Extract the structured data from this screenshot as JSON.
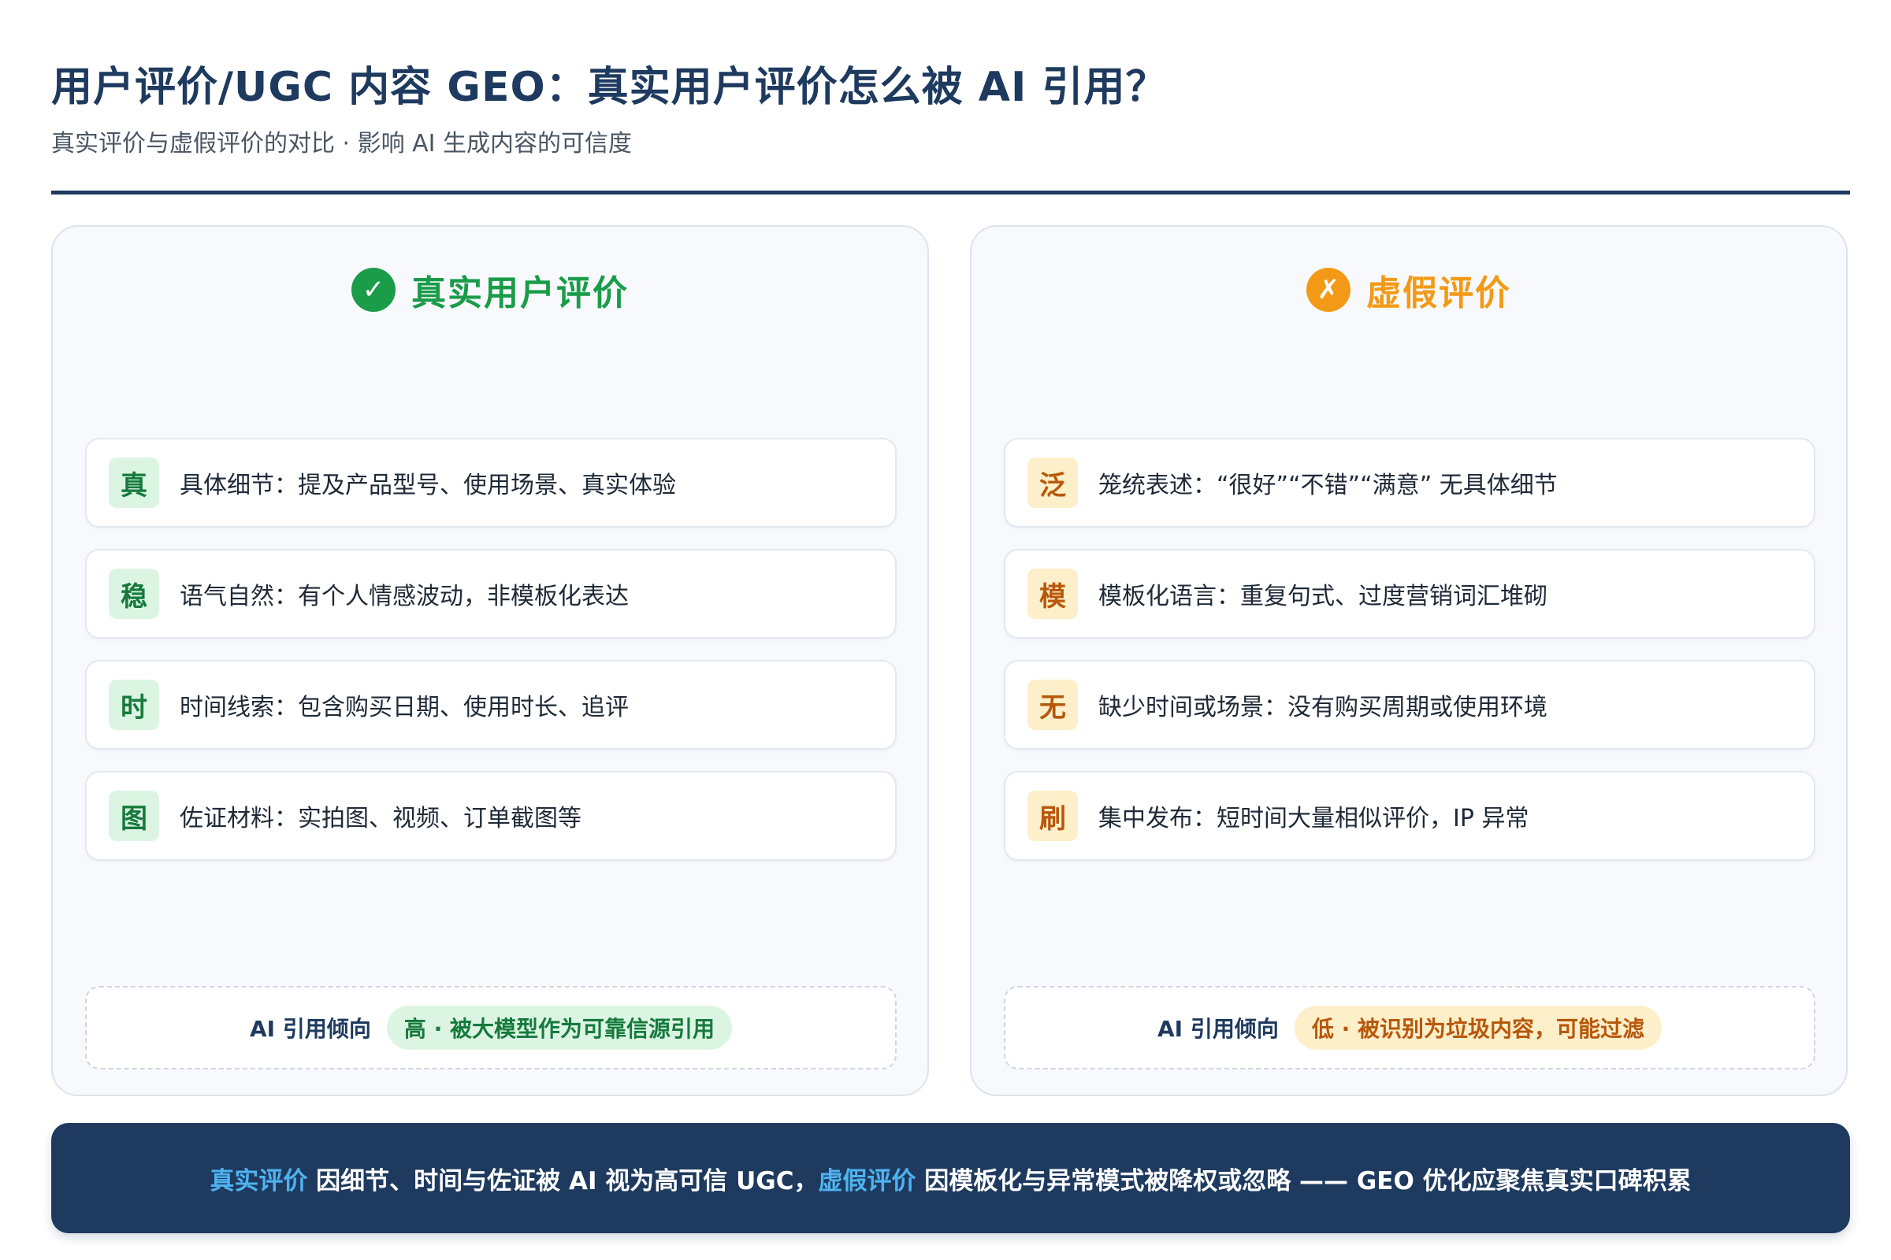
{
  "header": {
    "title": "用户评价/UGC 内容 GEO：真实用户评价怎么被 AI 引用？",
    "subtitle": "真实评价与虚假评价的对比 · 影响 AI 生成内容的可信度"
  },
  "colors": {
    "navy": "#1e3a5f",
    "green": "#1a9c49",
    "orange": "#f29a16",
    "highlight_blue": "#4fb3f0"
  },
  "left_panel": {
    "icon": "check-icon",
    "icon_glyph": "✓",
    "heading": "真实用户评价",
    "items": [
      {
        "badge": "真",
        "text": "具体细节：提及产品型号、使用场景、真实体验"
      },
      {
        "badge": "稳",
        "text": "语气自然：有个人情感波动，非模板化表达"
      },
      {
        "badge": "时",
        "text": "时间线索：包含购买日期、使用时长、追评"
      },
      {
        "badge": "图",
        "text": "佐证材料：实拍图、视频、订单截图等"
      }
    ],
    "footer_label": "AI 引用倾向",
    "footer_value": "高 · 被大模型作为可靠信源引用"
  },
  "right_panel": {
    "icon": "cross-icon",
    "icon_glyph": "✗",
    "heading": "虚假评价",
    "items": [
      {
        "badge": "泛",
        "text": "笼统表述：“很好”“不错”“满意” 无具体细节"
      },
      {
        "badge": "模",
        "text": "模板化语言：重复句式、过度营销词汇堆砌"
      },
      {
        "badge": "无",
        "text": "缺少时间或场景：没有购买周期或使用环境"
      },
      {
        "badge": "刷",
        "text": "集中发布：短时间大量相似评价，IP 异常"
      }
    ],
    "footer_label": "AI 引用倾向",
    "footer_value": "低 · 被识别为垃圾内容，可能过滤"
  },
  "banner": {
    "hl1": "真实评价",
    "part1": " 因细节、时间与佐证被 AI 视为高可信 UGC，",
    "hl2": "虚假评价",
    "part2": " 因模板化与异常模式被降权或忽略 —— GEO 优化应聚焦真实口碑积累"
  }
}
